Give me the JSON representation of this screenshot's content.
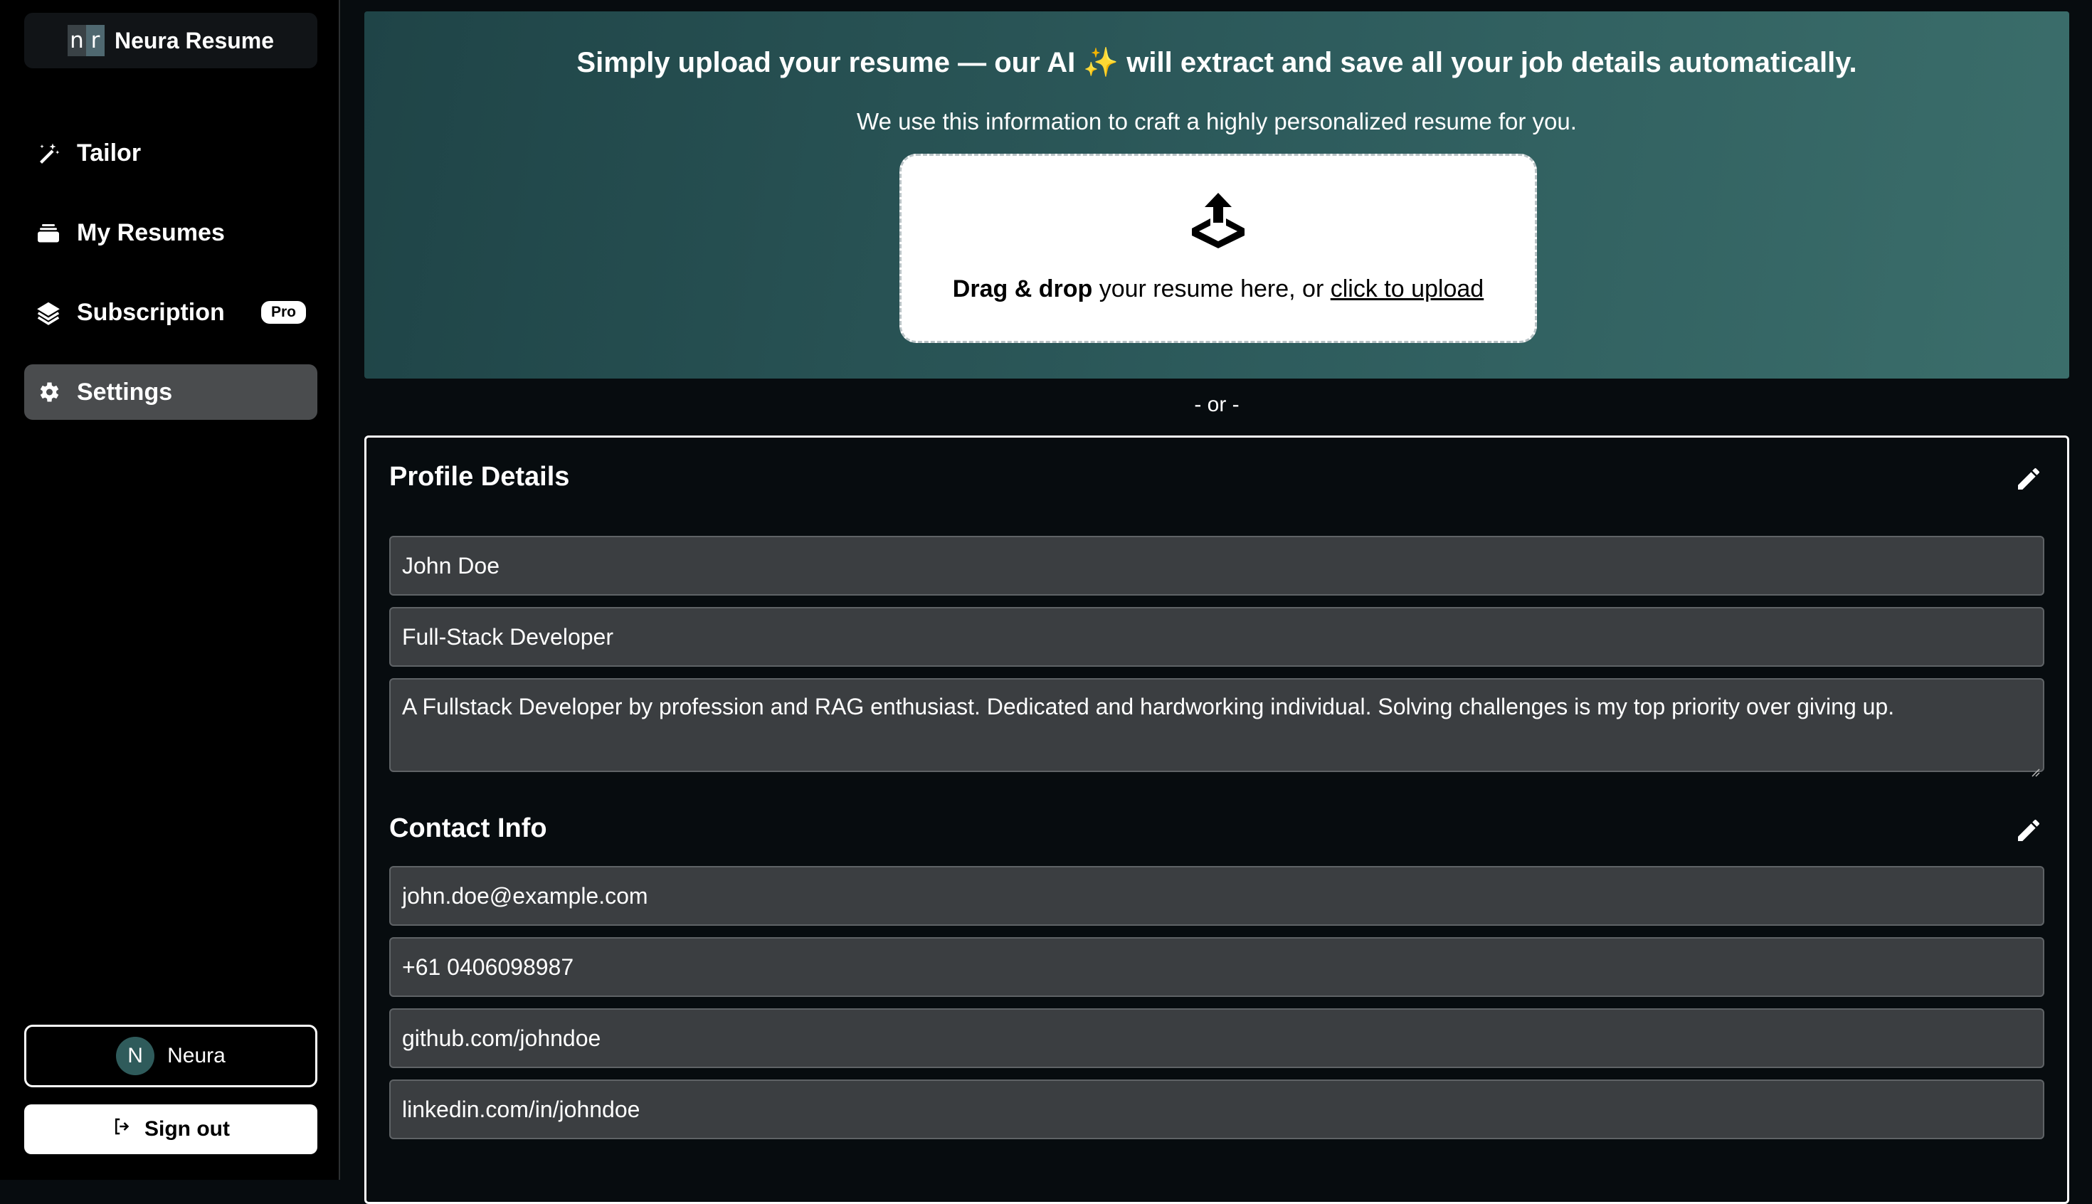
{
  "app": {
    "name": "Neura Resume",
    "logo_letters": [
      "n",
      "r"
    ]
  },
  "sidebar": {
    "items": [
      {
        "label": "Tailor",
        "icon": "magic-wand-icon"
      },
      {
        "label": "My Resumes",
        "icon": "stack-icon"
      },
      {
        "label": "Subscription",
        "icon": "layers-icon",
        "badge": "Pro"
      },
      {
        "label": "Settings",
        "icon": "gear-icon",
        "active": true
      }
    ],
    "user": {
      "initial": "N",
      "name": "Neura"
    },
    "signout_label": "Sign out"
  },
  "upload": {
    "title": "Simply upload your resume — our AI ✨ will extract and save all your job details automatically.",
    "subtitle": "We use this information to craft a highly personalized resume for you.",
    "drop_bold": "Drag & drop",
    "drop_text": " your resume here, or ",
    "drop_link": "click to upload"
  },
  "or_separator": "- or -",
  "profile": {
    "title": "Profile Details",
    "name": "John Doe",
    "role": "Full-Stack Developer",
    "summary": "A Fullstack Developer by profession and RAG enthusiast. Dedicated and hardworking individual. Solving challenges is my top priority over giving up."
  },
  "contact": {
    "title": "Contact Info",
    "email": "john.doe@example.com",
    "phone": "+61 0406098987",
    "github": "github.com/johndoe",
    "linkedin": "linkedin.com/in/johndoe"
  },
  "colors": {
    "accent": "#2e5c5d",
    "active_nav": "#4a4c4e",
    "field_bg": "#3b3e41"
  }
}
